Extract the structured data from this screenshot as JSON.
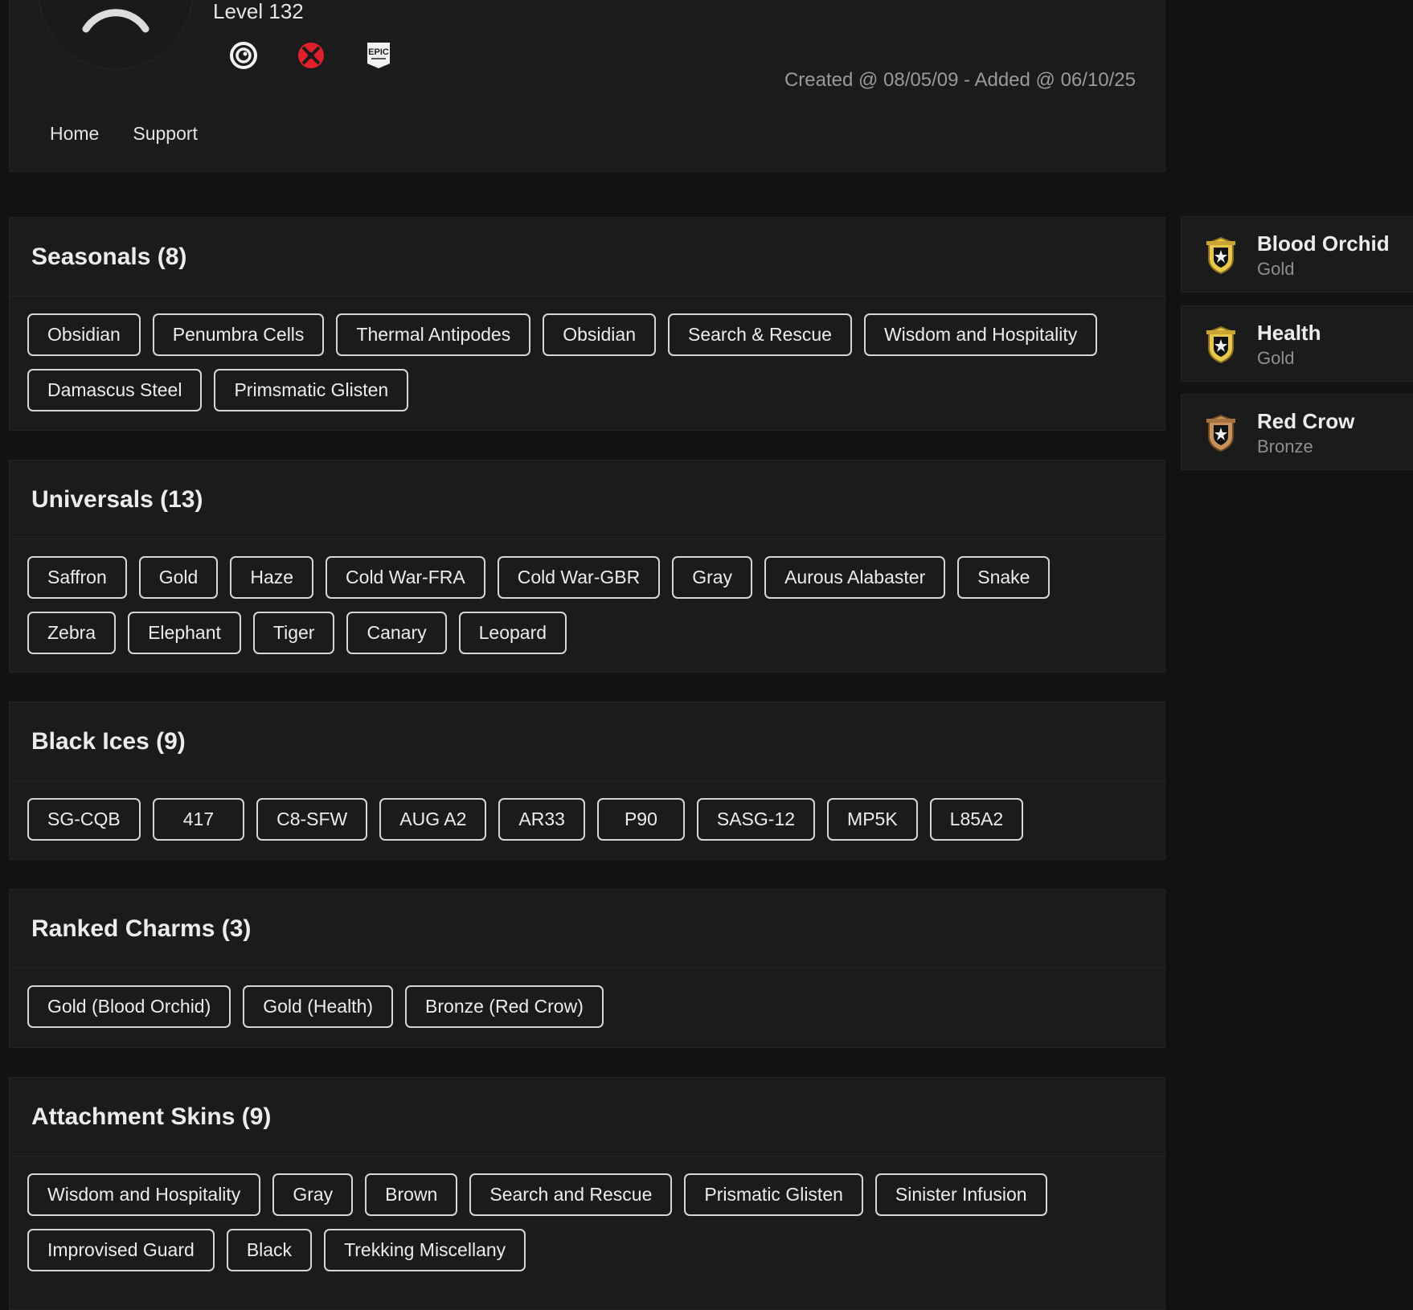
{
  "profile": {
    "level": "Level 132",
    "platforms": [
      {
        "icon": "ubisoft-icon"
      },
      {
        "icon": "xbox-icon"
      },
      {
        "icon": "epic-games-icon",
        "label": "EPIC"
      }
    ],
    "created": "Created @ 08/05/09 - Added @ 06/10/25",
    "nav": [
      "Home",
      "Support"
    ]
  },
  "sections": [
    {
      "title": "Seasonals (8)",
      "chips": [
        "Obsidian",
        "Penumbra Cells",
        "Thermal Antipodes",
        "Obsidian",
        "Search & Rescue",
        "Wisdom and Hospitality",
        "Damascus Steel",
        "Primsmatic Glisten"
      ]
    },
    {
      "title": "Universals (13)",
      "chips": [
        "Saffron",
        "Gold",
        "Haze",
        "Cold War-FRA",
        "Cold War-GBR",
        "Gray",
        "Aurous Alabaster",
        "Snake",
        "Zebra",
        "Elephant",
        "Tiger",
        "Canary",
        "Leopard"
      ]
    },
    {
      "title": "Black Ices (9)",
      "chips": [
        "SG-CQB",
        "417",
        "C8-SFW",
        "AUG A2",
        "AR33",
        "P90",
        "SASG-12",
        "MP5K",
        "L85A2"
      ]
    },
    {
      "title": "Ranked Charms (3)",
      "chips": [
        "Gold (Blood Orchid)",
        "Gold (Health)",
        "Bronze (Red Crow)"
      ]
    },
    {
      "title": "Attachment Skins (9)",
      "chips": [
        "Wisdom and Hospitality",
        "Gray",
        "Brown",
        "Search and Rescue",
        "Prismatic Glisten",
        "Sinister Infusion",
        "Improvised Guard",
        "Black",
        "Trekking Miscellany"
      ]
    }
  ],
  "ranks": [
    {
      "name": "Blood Orchid",
      "tier": "Gold",
      "icon": "gold-rank-badge-icon",
      "color": "#e7c84a"
    },
    {
      "name": "Health",
      "tier": "Gold",
      "icon": "gold-rank-badge-icon",
      "color": "#e7c84a"
    },
    {
      "name": "Red Crow",
      "tier": "Bronze",
      "icon": "bronze-rank-badge-icon",
      "color": "#c7925a"
    }
  ],
  "colors": {
    "background": "#111213",
    "card": "#1b1b1b",
    "xbox": "#e0202a"
  }
}
